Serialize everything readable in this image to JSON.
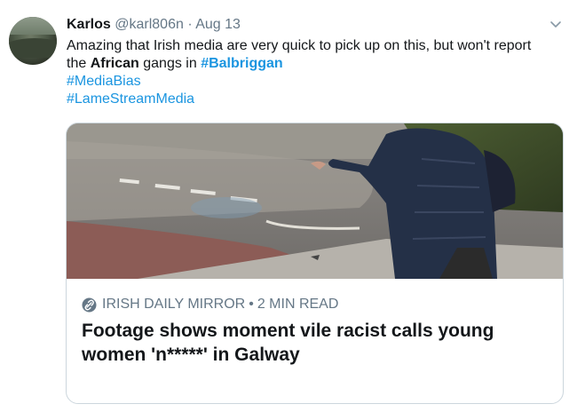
{
  "tweet": {
    "author_name": "Karlos",
    "handle": "@karl806n",
    "separator": "·",
    "date": "Aug 13",
    "text": {
      "line1": "Amazing that Irish media are very quick to pick up on this, but won't report",
      "line2_prefix": "the ",
      "line2_bold": "African",
      "line2_middle": " gangs in ",
      "line2_hashtag": "#Balbriggan",
      "hashtag2": "#MediaBias",
      "hashtag3": "#LameStreamMedia"
    },
    "menu_icon": "chevron-down-icon",
    "colors": {
      "link": "#1b95e0",
      "secondary": "#657786",
      "border": "#ccd6dd"
    }
  },
  "card": {
    "source_icon": "link-icon",
    "source": "IRISH DAILY MIRROR",
    "separator": "•",
    "read_time": "2 MIN READ",
    "title_line1": "Footage shows moment vile racist calls young",
    "title_line2": "women 'n*****' in Galway"
  }
}
